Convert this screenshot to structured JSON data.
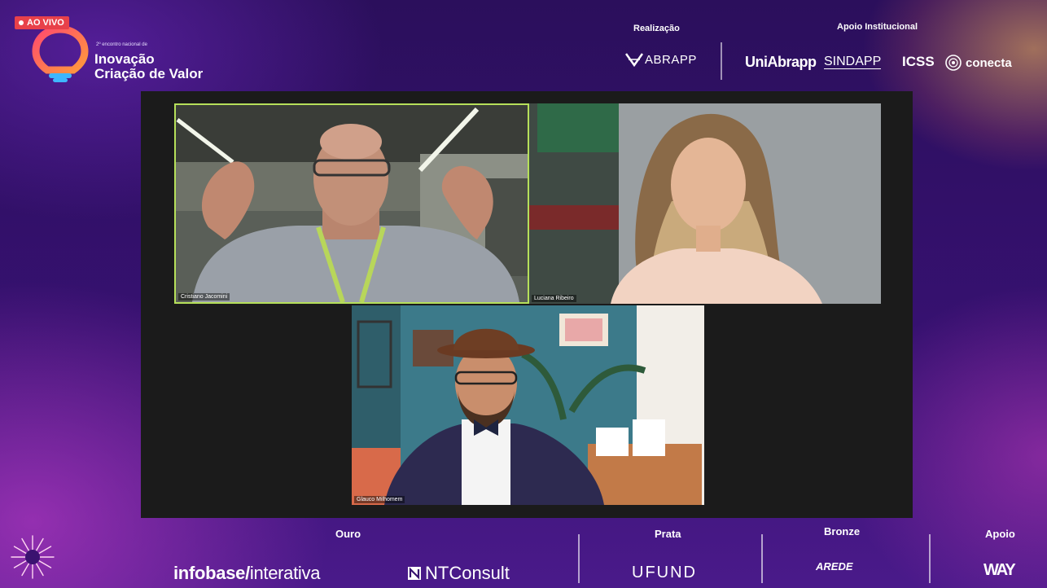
{
  "live_badge": {
    "label": "AO VIVO"
  },
  "event": {
    "small_text": "2º encontro nacional de",
    "title_line1": "Inovação",
    "title_line2": "Criação de Valor"
  },
  "header": {
    "realizacao_label": "Realização",
    "apoio_institucional_label": "Apoio Institucional",
    "realizacao_logo": "ABRAPP",
    "apoio_logos": [
      "UniAbrapp",
      "SINDAPP",
      "ICSS",
      "conecta"
    ]
  },
  "participants": [
    {
      "name": "Cristiano Jacomini"
    },
    {
      "name": "Luciana Ribeiro"
    },
    {
      "name": "Glauco Milhomem"
    }
  ],
  "footer": {
    "ouro_label": "Ouro",
    "prata_label": "Prata",
    "bronze_label": "Bronze",
    "apoio_label": "Apoio",
    "ouro_logo1_bold": "infobase",
    "ouro_logo1_rest": "interativa",
    "ouro_logo2": "NTConsult",
    "prata_logo": "UFUND",
    "bronze_logo": "AREDE",
    "apoio_logo": "WAY"
  },
  "colors": {
    "live_red": "#e8414a",
    "active_speaker_border": "#b6e05a",
    "background_purple": "#361170"
  }
}
